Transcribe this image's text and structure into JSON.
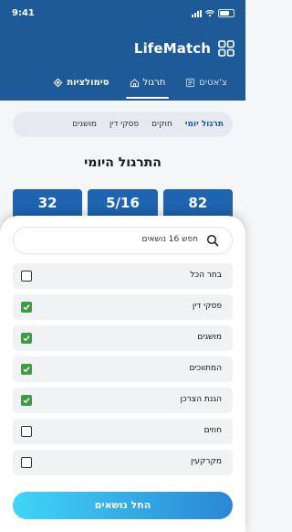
{
  "status_bar": {
    "time": "9:41"
  },
  "header": {
    "app_title": "LifeMatch",
    "tabs": [
      {
        "label": "צ'אטים",
        "icon": "chat-list-icon"
      },
      {
        "label": "תרגול",
        "icon": "home-icon",
        "active": true
      },
      {
        "label": "סימולציות",
        "icon": "diamond-icon"
      }
    ]
  },
  "practice": {
    "segments": [
      "תרגול יומי",
      "חוקים",
      "פסקי דין",
      "מושגים"
    ],
    "active_segment": "תרגול יומי",
    "title": "התרגול היומי",
    "stats": [
      "82",
      "5/16",
      "32"
    ]
  },
  "sheet": {
    "search_placeholder": "חפש 16 נושאים",
    "items": [
      {
        "label": "בחר הכל",
        "checked": false
      },
      {
        "label": "פסקי דין",
        "checked": true
      },
      {
        "label": "מושגים",
        "checked": true
      },
      {
        "label": "המתווכים",
        "checked": true
      },
      {
        "label": "הגנת הצרכן",
        "checked": true
      },
      {
        "label": "חוזים",
        "checked": false
      },
      {
        "label": "מקרקעין",
        "checked": false
      }
    ],
    "start_button": "החל נושאים"
  },
  "colors": {
    "header": "#1e5a98",
    "stat": "#1e64b0",
    "check": "#3f9c45",
    "button_start": "#3fd6f7",
    "button_end": "#2a86d4"
  }
}
